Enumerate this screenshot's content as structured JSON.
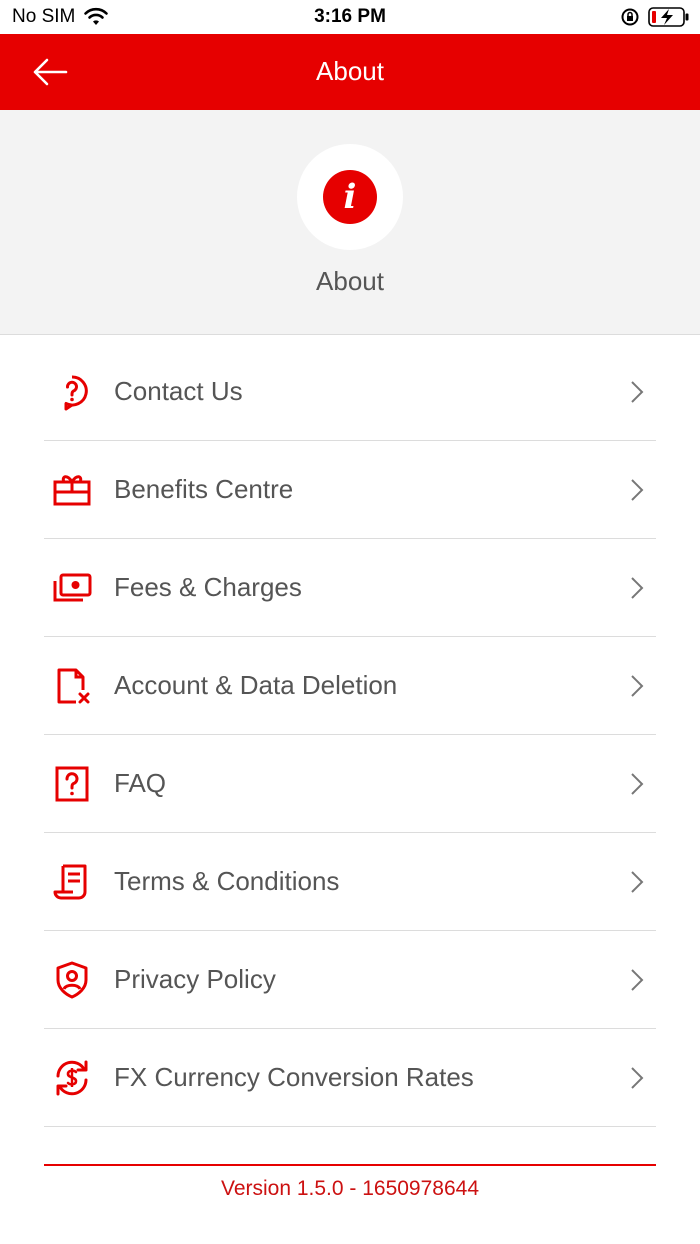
{
  "status_bar": {
    "carrier": "No SIM",
    "time": "3:16 PM"
  },
  "nav": {
    "title": "About"
  },
  "hero": {
    "icon_glyph": "i",
    "label": "About"
  },
  "menu": {
    "items": [
      {
        "label": "Contact Us",
        "icon": "contact-support-icon"
      },
      {
        "label": "Benefits Centre",
        "icon": "gift-icon"
      },
      {
        "label": "Fees & Charges",
        "icon": "money-icon"
      },
      {
        "label": "Account & Data Deletion",
        "icon": "file-delete-icon"
      },
      {
        "label": "FAQ",
        "icon": "question-box-icon"
      },
      {
        "label": "Terms & Conditions",
        "icon": "document-icon"
      },
      {
        "label": "Privacy Policy",
        "icon": "shield-user-icon"
      },
      {
        "label": "FX Currency Conversion Rates",
        "icon": "currency-exchange-icon"
      }
    ]
  },
  "footer": {
    "version": "Version 1.5.0 - 1650978644"
  },
  "colors": {
    "accent": "#e60000",
    "text": "#555555",
    "hero_bg": "#f3f3f3"
  }
}
